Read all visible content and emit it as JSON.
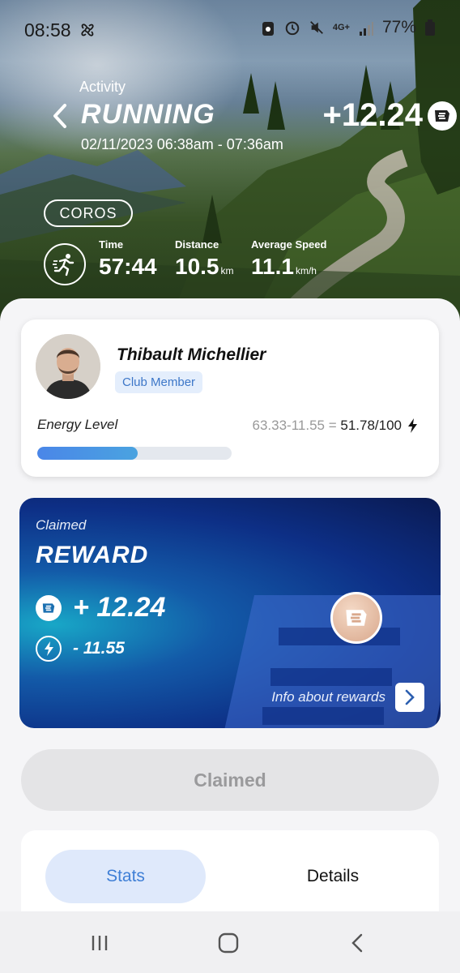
{
  "status_bar": {
    "time": "08:58",
    "network": "4G+",
    "battery": "77%"
  },
  "header": {
    "section_label": "Activity",
    "title": "RUNNING",
    "date_range": "02/11/2023 06:38am - 07:36am",
    "reward_amount": "+12.24",
    "source_badge": "COROS"
  },
  "stats": {
    "time_label": "Time",
    "time_value": "57:44",
    "distance_label": "Distance",
    "distance_value": "10.5",
    "distance_unit": "km",
    "speed_label": "Average Speed",
    "speed_value": "11.1",
    "speed_unit": "km/h"
  },
  "profile": {
    "name": "Thibault Michellier",
    "role_badge": "Club Member",
    "energy_label": "Energy Level",
    "energy_formula": "63.33-11.55 = ",
    "energy_result": "51.78/100",
    "energy_fraction": 0.5178
  },
  "reward_card": {
    "status_label": "Claimed",
    "title": "REWARD",
    "earned": "+ 12.24",
    "energy_spent": "- 11.55",
    "info_link": "Info about rewards"
  },
  "claim_button": {
    "label": "Claimed"
  },
  "tabs": [
    {
      "label": "Stats",
      "active": true
    },
    {
      "label": "Details",
      "active": false
    }
  ],
  "colors": {
    "accent_blue": "#3f7fd6",
    "reward_gradient_start": "#18a7c7",
    "reward_gradient_end": "#0a1a52"
  }
}
